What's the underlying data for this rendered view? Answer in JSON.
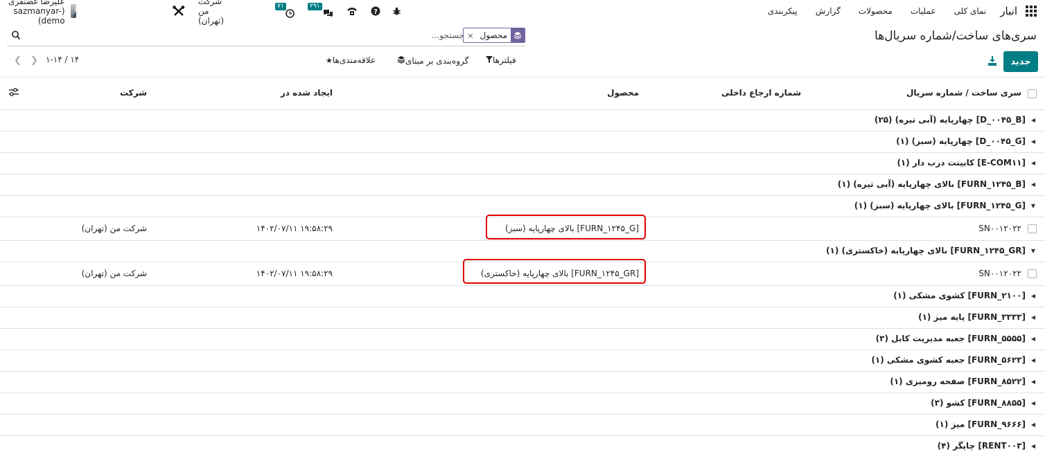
{
  "navbar": {
    "app_name": "انبار",
    "menu": [
      "نمای کلی",
      "عملیات",
      "محصولات",
      "گزارش",
      "پیکربندی"
    ],
    "discuss_count": "۲۹۱",
    "activity_count": "۷۱",
    "company": "شرکت من (تهران)",
    "user": "علیرضا غضنفری (sazmanyar-demo)"
  },
  "control": {
    "breadcrumb": "سری‌های ساخت/شماره سریال‌ها",
    "facet_value": "محصول",
    "facet_remove": "×",
    "search_placeholder": "جستجو...",
    "new_button": "جدید",
    "filters": "فیلترها",
    "groupby": "گروه‌بندی بر مبنای",
    "favorites": "علاقه‌مندی‌ها",
    "pager": "۱-۱۴ / ۱۴"
  },
  "table": {
    "headers": {
      "lot": "سری ساخت / شماره سریال",
      "ref": "شماره ارجاع داخلی",
      "product": "محصول",
      "created": "ایجاد شده در",
      "company": "شرکت"
    },
    "rows": [
      {
        "kind": "group",
        "label": "[D_۰۰۴۵_B] چهارپایه (آبی تیره) (۲۵)",
        "open": false
      },
      {
        "kind": "group",
        "label": "[D_۰۰۴۵_G] چهارپایه (سبز) (۱)",
        "open": false
      },
      {
        "kind": "group",
        "label": "[E-COM۱۱] کابینت درب دار (۱)",
        "open": false
      },
      {
        "kind": "group",
        "label": "[FURN_۱۲۴۵_B] بالای چهارپایه (آبی تیره) (۱)",
        "open": false
      },
      {
        "kind": "group",
        "label": "[FURN_۱۲۴۵_G] بالای چهارپایه (سبز) (۱)",
        "open": true
      },
      {
        "kind": "record",
        "lot": "SN۰۰۱۲۰۲۲",
        "product": "[FURN_۱۲۴۵_G] بالای چهارپایه (سبز)",
        "created": "۱۴۰۲/۰۷/۱۱ ۱۹:۵۸:۲۹",
        "company": "شرکت من (تهران)",
        "highlight": "narrow"
      },
      {
        "kind": "group",
        "label": "[FURN_۱۲۴۵_GR] بالای چهارپایه (خاکستری) (۱)",
        "open": true
      },
      {
        "kind": "record",
        "lot": "SN۰۰۱۲۰۲۲",
        "product": "[FURN_۱۲۴۵_GR] بالای چهارپایه (خاکستری)",
        "created": "۱۴۰۲/۰۷/۱۱ ۱۹:۵۸:۲۹",
        "company": "شرکت من (تهران)",
        "highlight": "wide"
      },
      {
        "kind": "group",
        "label": "[FURN_۲۱۰۰] کشوی مشکی (۱)",
        "open": false
      },
      {
        "kind": "group",
        "label": "[FURN_۳۳۳۳] پایه میز (۱)",
        "open": false
      },
      {
        "kind": "group",
        "label": "[FURN_۵۵۵۵] جعبه مدیریت کابل (۳)",
        "open": false
      },
      {
        "kind": "group",
        "label": "[FURN_۵۶۲۳] جعبه کشوی مشکی (۱)",
        "open": false
      },
      {
        "kind": "group",
        "label": "[FURN_۸۵۲۲] صفحه رومیزی (۱)",
        "open": false
      },
      {
        "kind": "group",
        "label": "[FURN_۸۸۵۵] کشو (۳)",
        "open": false
      },
      {
        "kind": "group",
        "label": "[FURN_۹۶۶۶] میز (۱)",
        "open": false
      },
      {
        "kind": "group",
        "label": "[RENT۰۰۳] چاپگر (۴)",
        "open": false
      }
    ]
  },
  "colors": {
    "primary": "#017e84",
    "facet": "#71639e",
    "highlight": "#e00000"
  }
}
